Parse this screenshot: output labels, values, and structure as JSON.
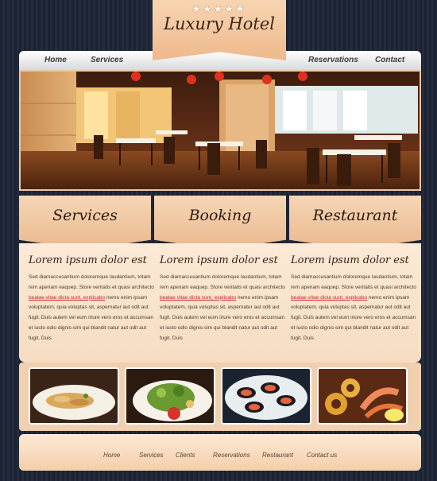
{
  "brand": {
    "stars": "★★★★★",
    "title": "Luxury Hotel"
  },
  "nav": {
    "home": "Home",
    "services": "Services",
    "reservations": "Reservations",
    "contact": "Contact"
  },
  "features": [
    {
      "label": "Services"
    },
    {
      "label": "Booking"
    },
    {
      "label": "Restaurant"
    }
  ],
  "columns": [
    {
      "heading": "Lorem ipsum dolor est",
      "text_a": "Sed diamaccusantium doloremque laudantium, totam rem aperiam eaquep. Store veritatis et quasi architecto ",
      "highlight": "beatae vitae dicta sunt, explicabo",
      "text_b": " nemo enim ipsam voluptatem, quia voluptas sit, aspernatur aut odit aut fugit. Duis autem vel eum iriure vero eros et accumsan et iusto odio dignis-sim qui blandit natur aut odit aut fugit. Duis"
    },
    {
      "heading": "Lorem ipsum dolor est",
      "text_a": "Sed diamaccusantium doloremque laudantium, totam rem aperiam eaquep. Store veritatis et quasi architecto ",
      "highlight": "beatae vitae dicta sunt, explicabo",
      "text_b": " nemo enim ipsam voluptatem, quia voluptas sit, aspernatur aut odit aut fugit. Duis autem vel eum iriure vero eros et accumsan et iusto odio dignis-sim qui blandit natur aut odit aut fugit. Duis"
    },
    {
      "heading": "Lorem ipsum dolor est",
      "text_a": "Sed diamaccusantium doloremque laudantium, totam rem aperiam eaquep. Store veritatis et quasi architecto ",
      "highlight": "beatae vitae dicta sunt, explicabo",
      "text_b": " nemo enim ipsam voluptatem, quia voluptas sit, aspernatur aut odit aut fugit. Duis autem vel eum iriure vero eros et accumsan et iusto odio dignis-sim qui blandit natur aut odit aut fugit. Duis"
    }
  ],
  "footer_nav": [
    "Home",
    "Services",
    "Clients",
    "Reservations",
    "Restaurant",
    "Contact us"
  ],
  "colors": {
    "accent": "#eeb98c",
    "panel": "#fbead7",
    "background": "#1b2232",
    "link_highlight": "#c2272d"
  }
}
